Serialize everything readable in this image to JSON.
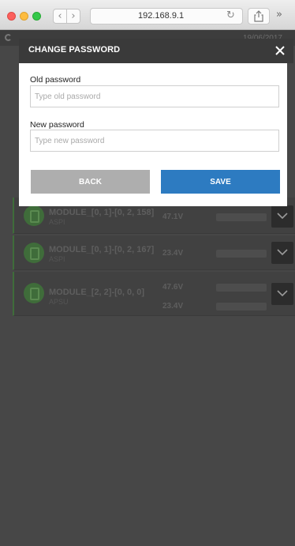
{
  "browser": {
    "url": "192.168.9.1",
    "back_glyph": "‹",
    "forward_glyph": "›",
    "reload_glyph": "↻",
    "more_glyph": "»"
  },
  "app": {
    "date": "19/06/2017",
    "modules": [
      {
        "name": "MODULE_[0, 1]-[0, 2, 158]",
        "type": "ASPI",
        "voltages": [
          "47.1V"
        ]
      },
      {
        "name": "MODULE_[0, 1]-[0, 2, 167]",
        "type": "ASPI",
        "voltages": [
          "23.4V"
        ]
      },
      {
        "name": "MODULE_[2, 2]-[0, 0, 0]",
        "type": "APSU",
        "voltages": [
          "47.6V",
          "23.4V"
        ]
      }
    ]
  },
  "modal": {
    "title": "CHANGE PASSWORD",
    "old_password": {
      "label": "Old password",
      "placeholder": "Type old password",
      "value": ""
    },
    "new_password": {
      "label": "New password",
      "placeholder": "Type new password",
      "value": ""
    },
    "back_label": "BACK",
    "save_label": "SAVE"
  },
  "colors": {
    "save_button": "#2d7bc1",
    "back_button": "#aeaeae",
    "modal_header": "#3a3a3a",
    "module_accent": "#3f6c3a"
  }
}
